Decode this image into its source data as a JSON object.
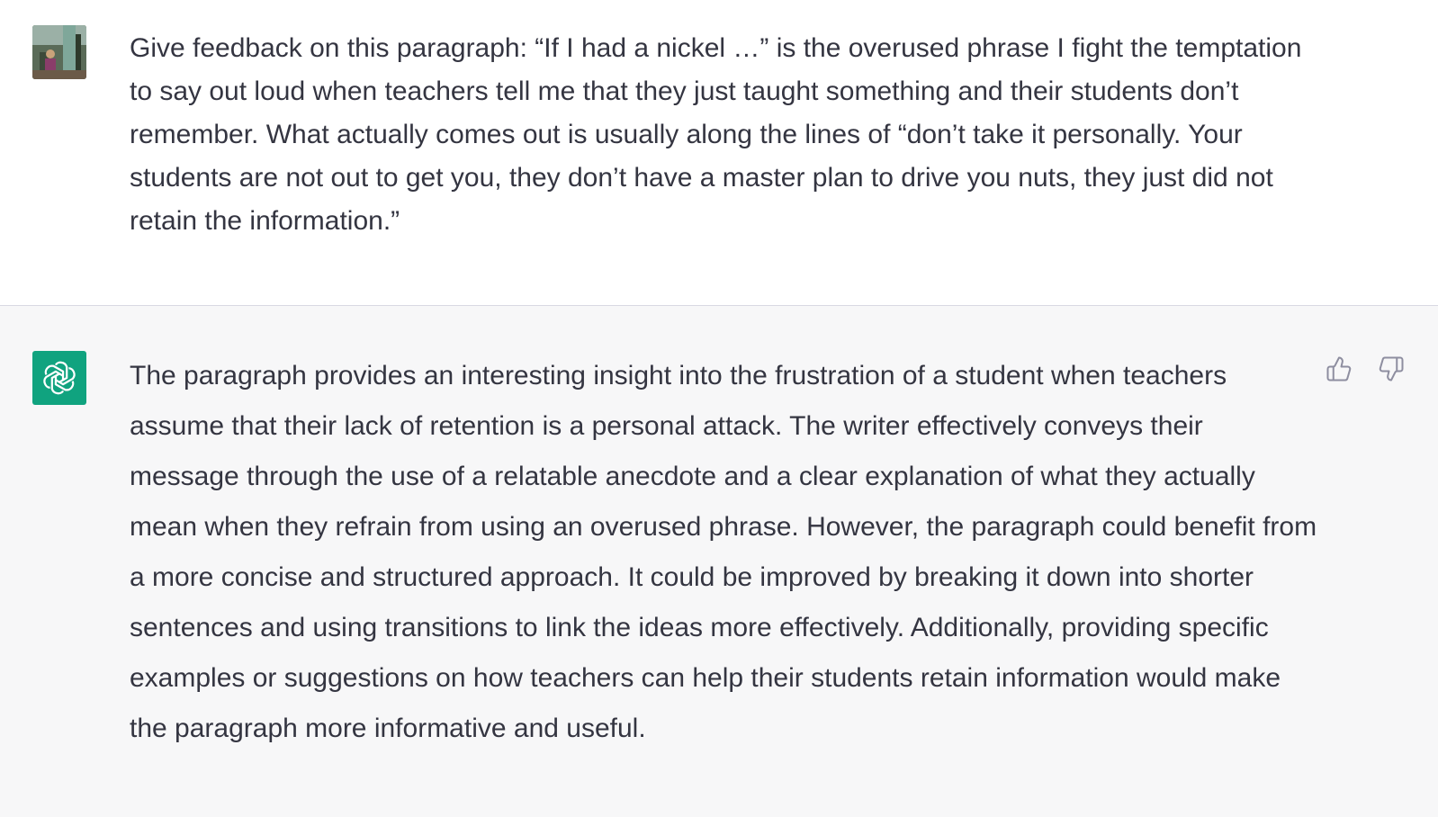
{
  "conversation": {
    "user_message": {
      "text": "Give feedback on this paragraph: “If I had a nickel …” is the overused phrase I fight the temptation to say out loud when teachers tell me that they just taught something and their students don’t remember. What actually comes out is usually along the lines of “don’t take it personally. Your students are not out to get you, they don’t have a master plan to drive you nuts, they just did not retain the information.”",
      "avatar_icon": "user-photo-avatar"
    },
    "assistant_message": {
      "text": "The paragraph provides an interesting insight into the frustration of a student when teachers assume that their lack of retention is a personal attack. The writer effectively conveys their message through the use of a relatable anecdote and a clear explanation of what they actually mean when they refrain from using an overused phrase. However, the paragraph could benefit from a more concise and structured approach. It could be improved by breaking it down into shorter sentences and using transitions to link the ideas more effectively. Additionally, providing specific examples or suggestions on how teachers can help their students retain information would make the paragraph more informative and useful.",
      "avatar_icon": "openai-logo-icon",
      "avatar_color": "#10a37f"
    },
    "feedback_icons": [
      "thumbs-up-icon",
      "thumbs-down-icon"
    ]
  },
  "colors": {
    "user_bg": "#ffffff",
    "assistant_bg": "#f7f7f8",
    "text": "#343541",
    "icon": "#8e8ea0",
    "divider": "#d9d9e3"
  }
}
